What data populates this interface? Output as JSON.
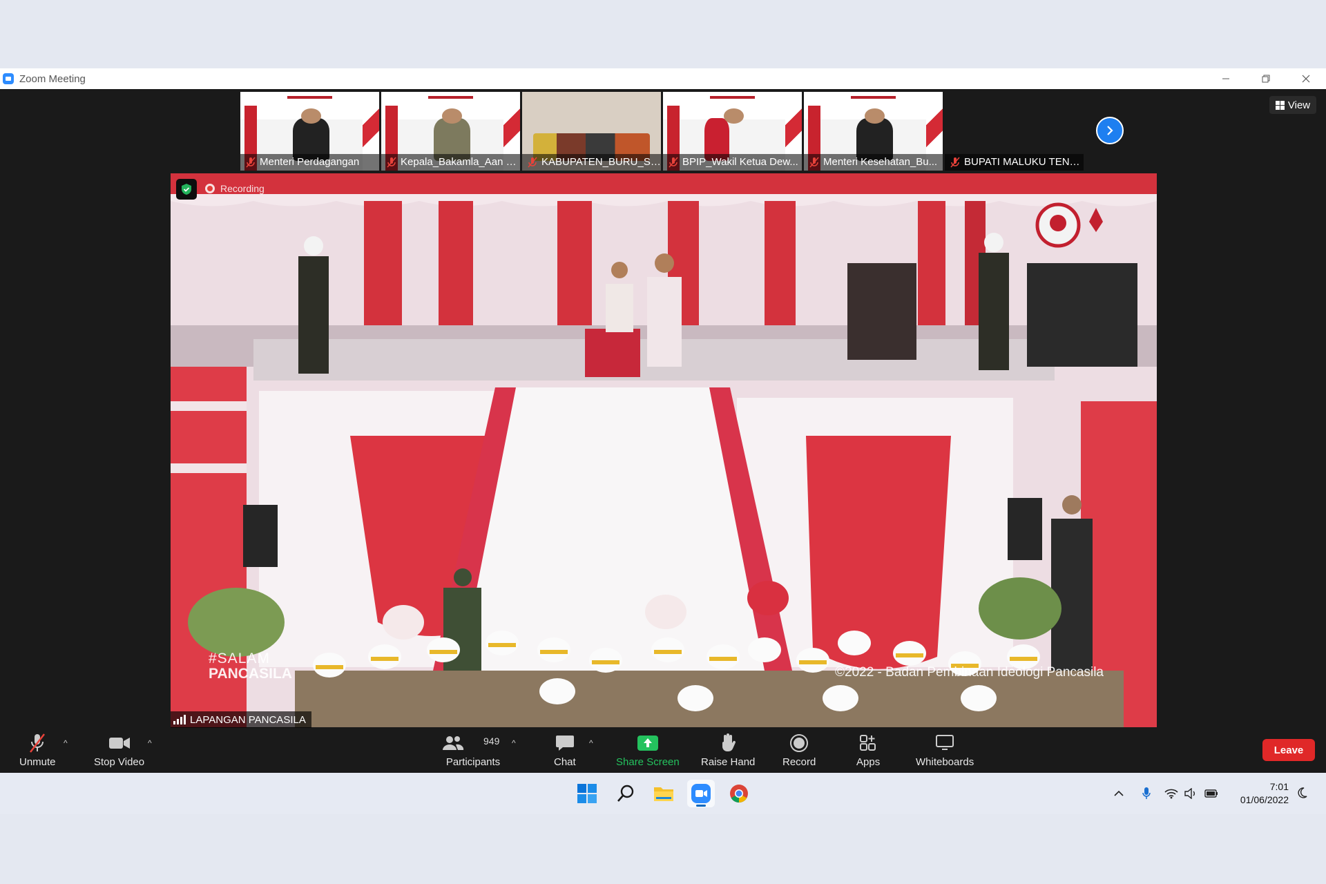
{
  "window": {
    "title": "Zoom Meeting"
  },
  "gallery": {
    "participants": [
      {
        "name": "Menteri Perdagangan"
      },
      {
        "name": "Kepala_Bakamla_Aan K..."
      },
      {
        "name": "KABUPATEN_BURU_SE..."
      },
      {
        "name": "BPIP_Wakil Ketua Dew..."
      },
      {
        "name": "Menteri Kesehatan_Bu..."
      },
      {
        "name": "BUPATI MALUKU TENG..."
      }
    ],
    "view_label": "View"
  },
  "video": {
    "recording_label": "Recording",
    "hashtag_line1": "#SALAM",
    "hashtag_line2": "PANCASILA",
    "copyright": "©2022 - Badan Pembinaan Ideologi Pancasila",
    "location": "LAPANGAN PANCASILA"
  },
  "toolbar": {
    "unmute": "Unmute",
    "stop_video": "Stop Video",
    "participants": "Participants",
    "participants_count": "949",
    "chat": "Chat",
    "share_screen": "Share Screen",
    "raise_hand": "Raise Hand",
    "record": "Record",
    "apps": "Apps",
    "whiteboards": "Whiteboards",
    "leave": "Leave",
    "caret": "^"
  },
  "taskbar": {
    "time": "7:01",
    "date": "01/06/2022"
  },
  "colors": {
    "accent_blue": "#2d8cff",
    "leave_red": "#e02828",
    "share_green": "#24c25e"
  }
}
